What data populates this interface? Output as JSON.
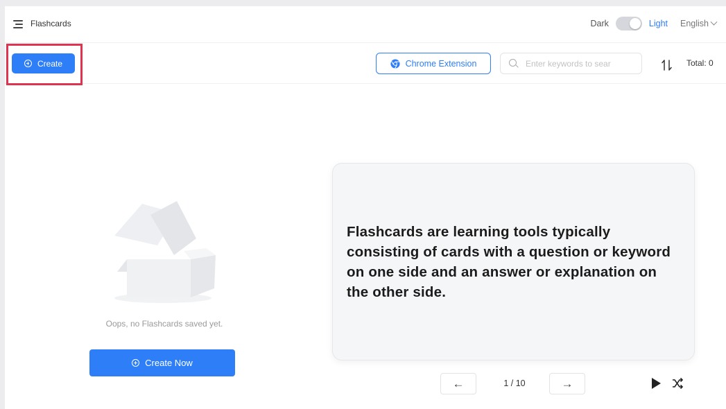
{
  "header": {
    "title": "Flashcards",
    "theme_dark_label": "Dark",
    "theme_light_label": "Light",
    "language": "English"
  },
  "toolbar": {
    "create_label": "Create",
    "extension_label": "Chrome Extension",
    "search_placeholder": "Enter keywords to sear",
    "search_value": "",
    "total_label": "Total: 0"
  },
  "empty_state": {
    "message": "Oops, no Flashcards saved yet.",
    "create_now_label": "Create Now"
  },
  "flashcard": {
    "text": "Flashcards are learning tools typically consisting of cards with a question or keyword on one side and an answer or explanation on the other side."
  },
  "pager": {
    "indicator": "1 / 10",
    "prev_icon": "←",
    "next_icon": "→"
  },
  "colors": {
    "accent": "#2d7ef7",
    "highlight": "#e0334f"
  },
  "icons": {
    "menu": "menu-icon",
    "chrome": "chrome-icon",
    "search": "search-icon",
    "sort": "sort-icon",
    "play": "play-icon",
    "shuffle": "shuffle-icon",
    "empty_box": "empty-box-icon"
  }
}
